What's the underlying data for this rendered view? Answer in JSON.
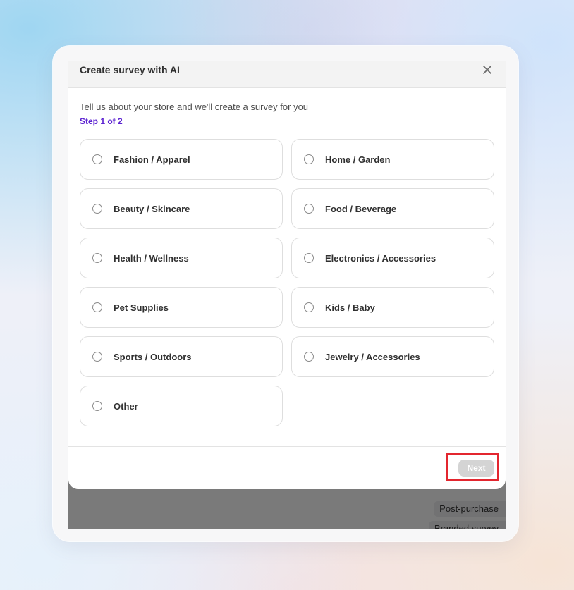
{
  "background_app": {
    "chips": [
      "Post-purchase",
      "Branded survey",
      ""
    ]
  },
  "modal": {
    "title": "Create survey with AI",
    "close_icon": "close-icon",
    "intro": "Tell us about your store and we'll create a survey for you",
    "step": "Step 1 of 2",
    "options": [
      {
        "label": "Fashion / Apparel",
        "selected": false
      },
      {
        "label": "Home / Garden",
        "selected": false
      },
      {
        "label": "Beauty / Skincare",
        "selected": false
      },
      {
        "label": "Food / Beverage",
        "selected": false
      },
      {
        "label": "Health / Wellness",
        "selected": false
      },
      {
        "label": "Electronics / Accessories",
        "selected": false
      },
      {
        "label": "Pet Supplies",
        "selected": false
      },
      {
        "label": "Kids / Baby",
        "selected": false
      },
      {
        "label": "Sports / Outdoors",
        "selected": false
      },
      {
        "label": "Jewelry / Accessories",
        "selected": false
      },
      {
        "label": "Other",
        "selected": false
      }
    ],
    "next_label": "Next",
    "next_disabled": true
  },
  "colors": {
    "accent": "#5b21d1",
    "highlight": "#e3262f",
    "disabled_button": "#d4d4d4"
  }
}
